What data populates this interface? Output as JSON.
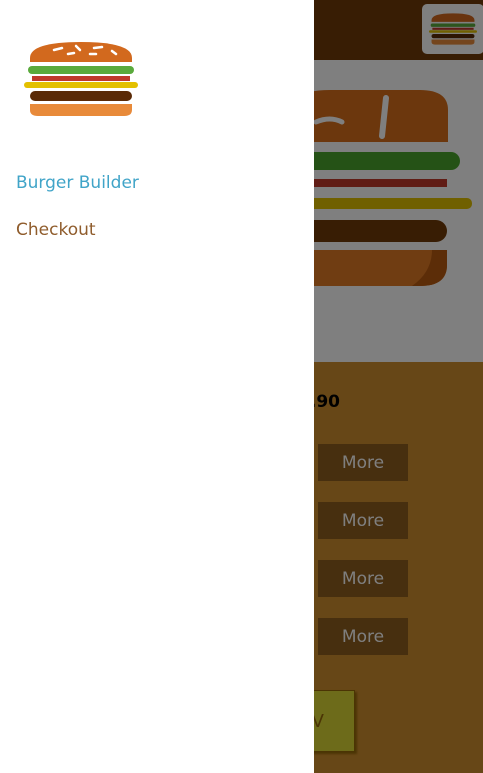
{
  "toolbar": {
    "logo_icon": "burger-logo-icon"
  },
  "preview": {
    "burger_icon": "burger-illustration"
  },
  "controls": {
    "price_text": ".90",
    "more_label": "More",
    "order_label": "V"
  },
  "drawer": {
    "logo_icon": "burger-logo-icon",
    "nav": [
      {
        "label": "Burger Builder",
        "active": true
      },
      {
        "label": "Checkout",
        "active": false
      }
    ]
  },
  "colors": {
    "toolbar": "#703b09",
    "controls": "#cf8f2e",
    "button": "#8f5e1e",
    "active_link": "#40a4c8",
    "link": "#8f5c2c"
  }
}
